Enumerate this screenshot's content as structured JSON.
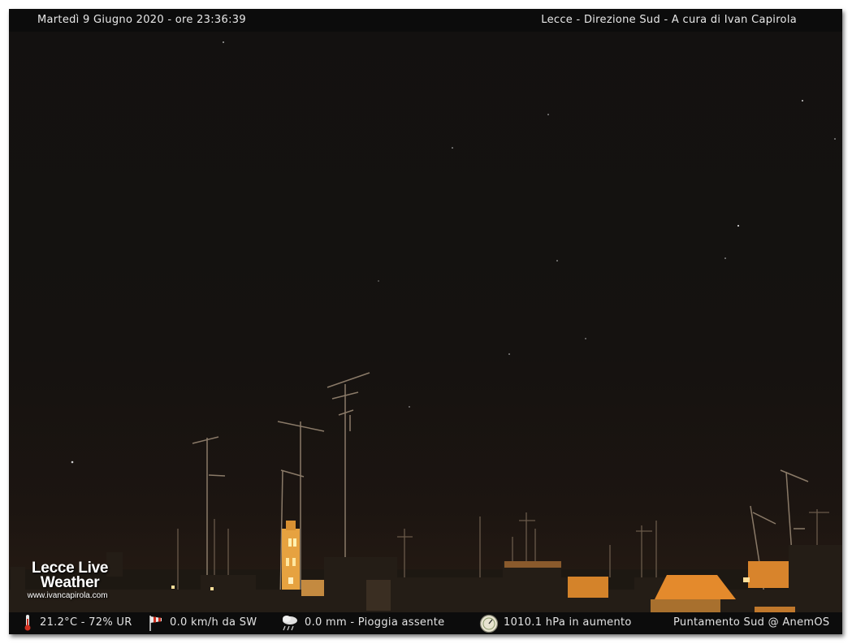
{
  "header": {
    "datetime": "Martedì 9 Giugno 2020 - ore 23:36:39",
    "location": "Lecce - Direzione Sud - A cura di Ivan Capirola"
  },
  "logo": {
    "line1": "Lecce Live",
    "line2": "Weather",
    "url": "www.ivancapirola.com"
  },
  "footer": {
    "temperature_humidity": "21.2°C - 72% UR",
    "wind": "0.0 km/h da SW",
    "rain": "0.0 mm - Pioggia assente",
    "pressure": "1010.1 hPa in aumento",
    "pointing": "Puntamento Sud @ AnemOS",
    "icons": [
      "thermometer-icon",
      "windsock-icon",
      "rain-cloud-icon",
      "barometer-icon"
    ]
  },
  "colors": {
    "sky": "#131110",
    "bar_background": "#0c0c0c",
    "text": "#e8e8e8",
    "city_light": "#e08a2c"
  }
}
